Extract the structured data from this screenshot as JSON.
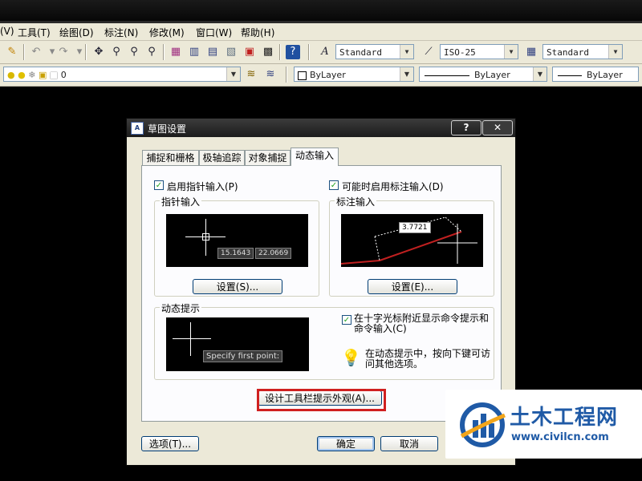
{
  "menu": [
    "(V)",
    "工具(T)",
    "绘图(D)",
    "标注(N)",
    "修改(M)",
    "窗口(W)",
    "帮助(H)"
  ],
  "toolbar": {
    "text_style": "Standard",
    "dim_style": "ISO-25",
    "table_style": "Standard",
    "layer_value": "0",
    "color": "ByLayer",
    "linetype": "ByLayer",
    "lineweight": "ByLayer"
  },
  "dialog": {
    "title": "草图设置",
    "help_btn": "?",
    "close_btn": "✕",
    "tabs": [
      "捕捉和栅格",
      "极轴追踪",
      "对象捕捉",
      "动态输入"
    ],
    "active_tab": "动态输入",
    "pointer": {
      "checkbox_label": "启用指针输入(P)",
      "group_title": "指针输入",
      "coord_x": "15.1643",
      "coord_y": "22.0669",
      "settings_btn": "设置(S)..."
    },
    "dim": {
      "checkbox_label": "可能时启用标注输入(D)",
      "group_title": "标注输入",
      "value": "3.7721",
      "settings_btn": "设置(E)..."
    },
    "prompt": {
      "group_title": "动态提示",
      "preview_text": "Specify first point:",
      "checkbox_label_line1": "在十字光标附近显示命令提示和",
      "checkbox_label_line2": "命令输入(C)",
      "tip_line1": "在动态提示中，按向下键可访",
      "tip_line2": "问其他选项。"
    },
    "design_btn": "设计工具栏提示外观(A)...",
    "options_btn": "选项(T)...",
    "ok_btn": "确定",
    "cancel_btn": "取消"
  },
  "watermark": {
    "text": "土木工程网",
    "url": "www.civilcn.com"
  }
}
